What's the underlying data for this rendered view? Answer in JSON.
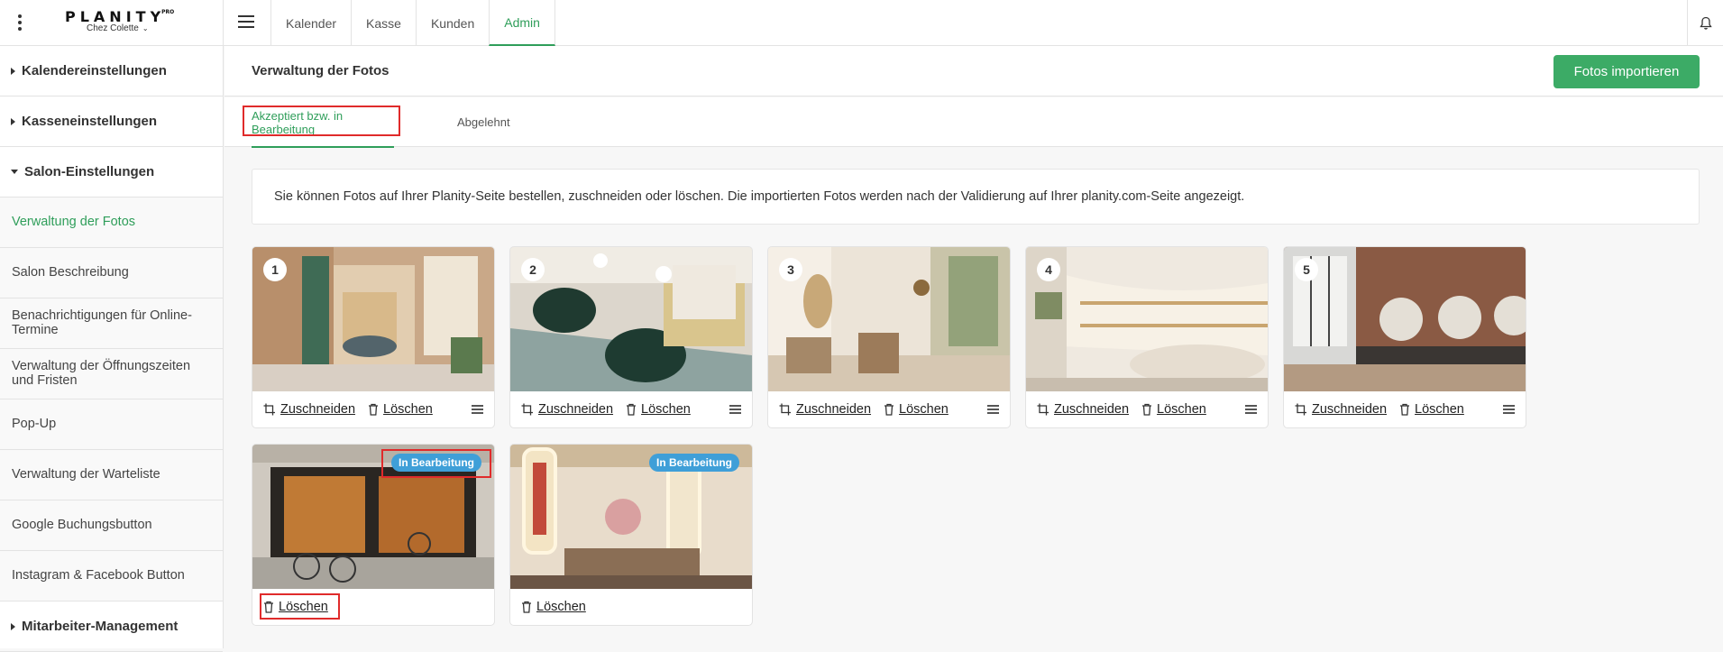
{
  "topbar": {
    "logo": "PLANITY",
    "logo_sup": "PRO",
    "salon": "Chez Colette",
    "tabs": [
      "Kalender",
      "Kasse",
      "Kunden",
      "Admin"
    ],
    "active_tab": "Admin"
  },
  "sidebar": {
    "sections": {
      "kalender": "Kalendereinstellungen",
      "kasse": "Kasseneinstellungen",
      "salon": "Salon-Einstellungen",
      "mitarbeiter": "Mitarbeiter-Management"
    },
    "items": [
      "Verwaltung der Fotos",
      "Salon Beschreibung",
      "Benachrichtigungen für Online-Termine",
      "Verwaltung der Öffnungszeiten und Fristen",
      "Pop-Up",
      "Verwaltung der Warteliste",
      "Google Buchungsbutton",
      "Instagram & Facebook Button"
    ]
  },
  "main": {
    "title": "Verwaltung der Fotos",
    "import_button": "Fotos importieren",
    "tabs": [
      "Akzeptiert bzw. in Bearbeitung",
      "Abgelehnt"
    ],
    "info": "Sie können Fotos auf Ihrer Planity-Seite bestellen, zuschneiden oder löschen. Die importierten Fotos werden nach der Validierung auf Ihrer planity.com-Seite angezeigt.",
    "actions": {
      "crop": "Zuschneiden",
      "delete": "Löschen"
    },
    "badge": "In Bearbeitung",
    "photos": [
      {
        "number": "1"
      },
      {
        "number": "2"
      },
      {
        "number": "3"
      },
      {
        "number": "4"
      },
      {
        "number": "5"
      }
    ]
  },
  "colors": {
    "accent": "#2f9e5a",
    "button": "#3cab66",
    "badge": "#3f9fd8",
    "highlight": "#e02b2b"
  }
}
